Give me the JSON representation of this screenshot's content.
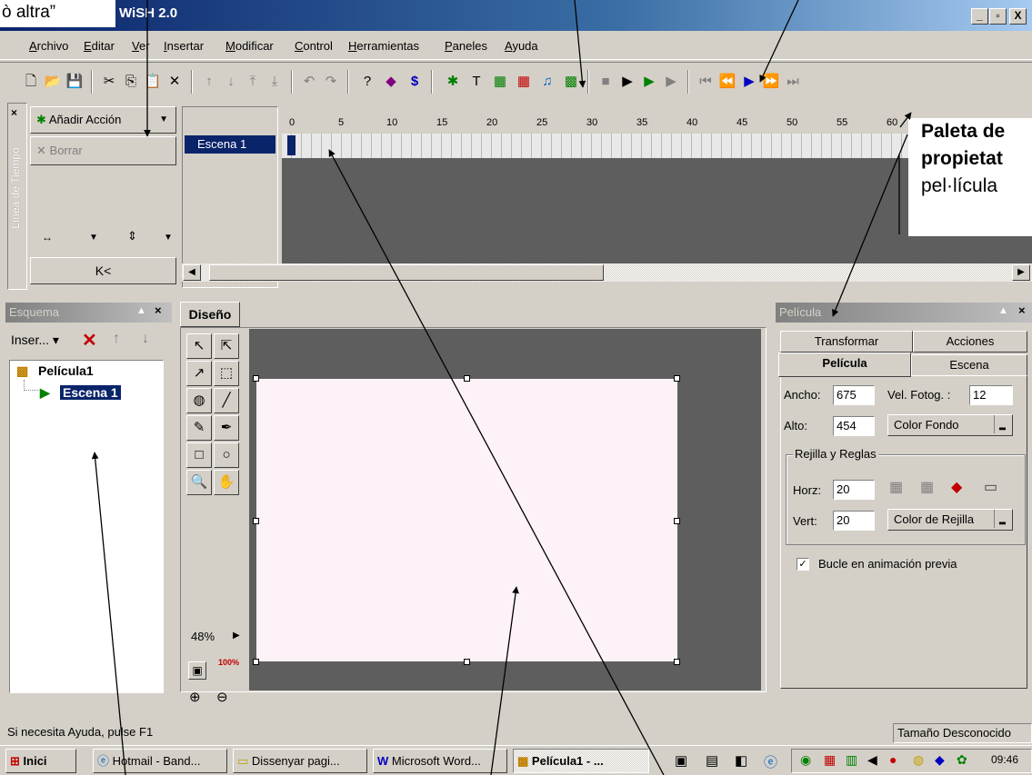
{
  "window": {
    "title": "WiSH 2.0",
    "min": "_",
    "max": "▫",
    "close": "X"
  },
  "callouts": {
    "top_left": "ò altra”",
    "paleta_line1": "Paleta de",
    "paleta_line2": "propietat",
    "paleta_line3": "pel·lícula"
  },
  "menu": [
    "Archivo",
    "Editar",
    "Ver",
    "Insertar",
    "Modificar",
    "Control",
    "Herramientas",
    "Paneles",
    "Ayuda"
  ],
  "menu_underline": [
    "A",
    "E",
    "V",
    "I",
    "M",
    "C",
    "H",
    "P",
    "A"
  ],
  "timeline": {
    "side_label": "Línea de Tiempo",
    "add_action": "Añadir Acción",
    "delete": "Borrar",
    "first_frame": "K<",
    "scene": "Escena 1",
    "ruler": [
      "0",
      "5",
      "10",
      "15",
      "20",
      "25",
      "30",
      "35",
      "40",
      "45",
      "50",
      "55",
      "60"
    ]
  },
  "outline": {
    "title": "Esquema",
    "insert": "Inser...",
    "root": "Película1",
    "child": "Escena 1"
  },
  "design": {
    "tab": "Diseño",
    "zoom": "48%",
    "zoom_100": "100%"
  },
  "properties": {
    "title": "Película",
    "tabs_back": [
      "Transformar",
      "Acciones"
    ],
    "tabs_front": [
      "Película",
      "Escena"
    ],
    "width_label": "Ancho:",
    "width_value": "675",
    "fps_label": "Vel. Fotog. :",
    "fps_value": "12",
    "height_label": "Alto:",
    "height_value": "454",
    "bg_color": "Color Fondo",
    "grid_group": "Rejilla y Reglas",
    "horz_label": "Horz:",
    "horz_value": "20",
    "vert_label": "Vert:",
    "vert_value": "20",
    "grid_color": "Color de Rejilla",
    "loop_label": "Bucle en animación previa",
    "loop_checked": "✓"
  },
  "status": {
    "left": "Si necesita Ayuda, pulse F1",
    "right": "Tamaño Desconocido"
  },
  "taskbar": {
    "start": "Inici",
    "tasks": [
      "Hotmail - Band...",
      "Dissenyar pagi...",
      "Microsoft Word...",
      "Película1 - ..."
    ],
    "clock": "09:46"
  },
  "colors": {
    "titlebar": "#0a246a",
    "face": "#d4d0c8",
    "stage": "#fdf2f8",
    "workspace": "#5e5e5e"
  }
}
